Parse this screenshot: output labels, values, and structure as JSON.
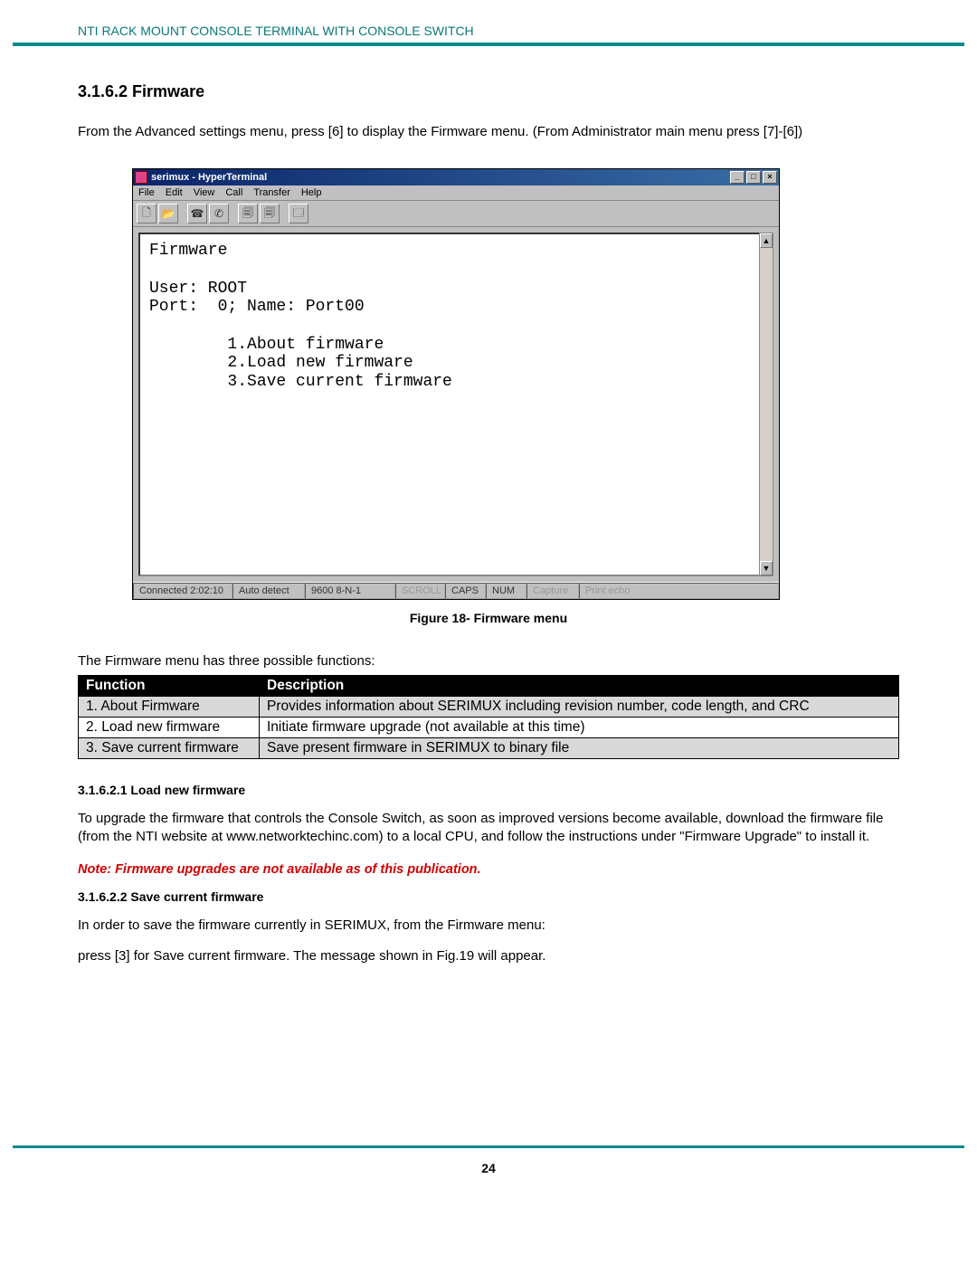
{
  "header": {
    "running_title": "NTI RACK MOUNT CONSOLE TERMINAL WITH CONSOLE SWITCH"
  },
  "section": {
    "number_title": "3.1.6.2 Firmware",
    "intro": "From the Advanced settings menu, press [6] to display the Firmware menu.  (From Administrator main menu press [7]-[6])"
  },
  "hyperterminal": {
    "title": "serimux - HyperTerminal",
    "menubar": [
      "File",
      "Edit",
      "View",
      "Call",
      "Transfer",
      "Help"
    ],
    "toolbar_icons": [
      "new-file-icon",
      "open-icon",
      "phone-icon",
      "hangup-icon",
      "send-icon",
      "receive-icon",
      "properties-icon"
    ],
    "terminal_lines": [
      "Firmware",
      "",
      "User: ROOT",
      "Port:  0; Name: Port00",
      "",
      "        1.About firmware",
      "        2.Load new firmware",
      "        3.Save current firmware"
    ],
    "status": {
      "connected": "Connected 2:02:10",
      "detect": "Auto detect",
      "settings": "9600 8-N-1",
      "scroll": "SCROLL",
      "caps": "CAPS",
      "num": "NUM",
      "capture": "Capture",
      "echo": "Print echo"
    }
  },
  "figure_caption": "Figure 18- Firmware menu",
  "para_after_fig": "The Firmware menu has three possible functions:",
  "table": {
    "headers": [
      "Function",
      "Description"
    ],
    "rows": [
      {
        "fn": "1. About Firmware",
        "desc": "Provides information about SERIMUX including revision number, code length, and CRC"
      },
      {
        "fn": "2. Load new firmware",
        "desc": "Initiate firmware upgrade  (not available at this time)"
      },
      {
        "fn": "3. Save current firmware",
        "desc": "Save present firmware in SERIMUX to binary file"
      }
    ]
  },
  "sub1": {
    "heading": "3.1.6.2.1 Load new firmware",
    "body": "To upgrade the firmware that controls the Console Switch, as soon as improved versions become available, download the firmware file (from the NTI website at www.networktechinc.com) to a local CPU, and follow the instructions under  \"Firmware Upgrade\" to install it."
  },
  "note_text": "Note:  Firmware upgrades are not available as of this publication.",
  "sub2": {
    "heading": "3.1.6.2.2 Save current firmware",
    "body1": "In order to save the firmware currently in SERIMUX, from the Firmware menu:",
    "body2": " press [3]  for Save current firmware.   The message shown in Fig.19  will appear."
  },
  "page_number": "24"
}
